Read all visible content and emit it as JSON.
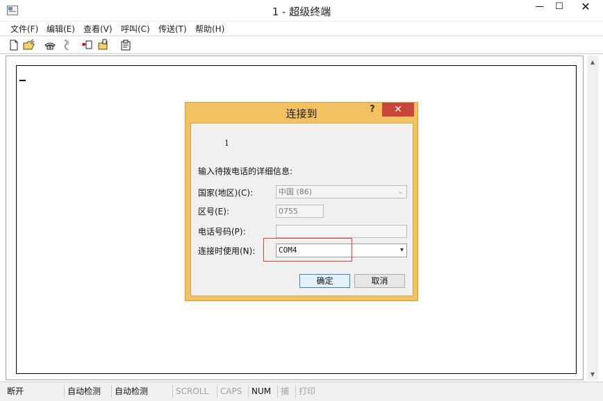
{
  "window": {
    "title": "1 - 超级终端",
    "min_glyph": "—",
    "max_glyph": "☐",
    "close_glyph": "✕"
  },
  "menu": [
    {
      "label": "文件(F)"
    },
    {
      "label": "编辑(E)"
    },
    {
      "label": "查看(V)"
    },
    {
      "label": "呼叫(C)"
    },
    {
      "label": "传送(T)"
    },
    {
      "label": "帮助(H)"
    }
  ],
  "toolbar": {
    "icons": [
      "new-file-icon",
      "open-folder-icon",
      "call-phone-icon",
      "disconnect-icon",
      "send-icon",
      "receive-icon",
      "properties-icon"
    ]
  },
  "statusbar": [
    {
      "label": "断开",
      "dim": false
    },
    {
      "label": "自动检测",
      "dim": false
    },
    {
      "label": "自动检测",
      "dim": false
    },
    {
      "label": "SCROLL",
      "dim": true
    },
    {
      "label": "CAPS",
      "dim": true
    },
    {
      "label": "NUM",
      "dim": false
    },
    {
      "label": "捕",
      "dim": true
    },
    {
      "label": "打印",
      "dim": true
    }
  ],
  "dialog": {
    "title": "连接到",
    "help_glyph": "?",
    "close_glyph": "✕",
    "connection_name": "1",
    "prompt": "输入待拨电话的详细信息:",
    "country_label": "国家(地区)(C):",
    "country_value": "中国 (86)",
    "area_label": "区号(E):",
    "area_value": "0755",
    "phone_label": "电话号码(P):",
    "phone_value": "",
    "connect_using_label": "连接时使用(N):",
    "connect_using_value": "COM4",
    "ok_label": "确定",
    "cancel_label": "取消"
  }
}
